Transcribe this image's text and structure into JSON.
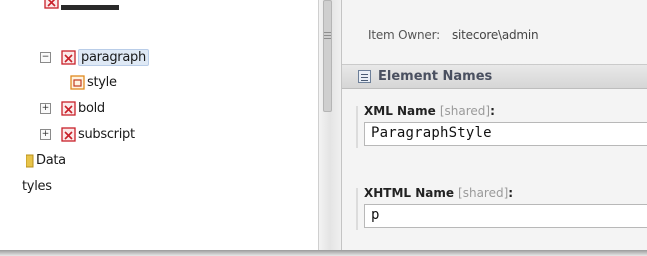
{
  "tree": {
    "items": [
      {
        "label": "",
        "icon": "rendering-icon",
        "expander": "",
        "cut": true
      },
      {
        "label": "paragraph",
        "icon": "rendering-icon",
        "expander": "−",
        "selected": true
      },
      {
        "label": "style",
        "icon": "template-icon",
        "expander": ""
      },
      {
        "label": "bold",
        "icon": "rendering-icon",
        "expander": "+"
      },
      {
        "label": "subscript",
        "icon": "rendering-icon",
        "expander": "+"
      },
      {
        "label": "Data",
        "icon": "folder-icon",
        "expander": ""
      },
      {
        "label": "tyles",
        "icon": "",
        "expander": ""
      }
    ]
  },
  "content": {
    "owner_label": "Item Owner:",
    "owner_value": "sitecore\\admin",
    "section": {
      "title": "Element Names",
      "icon": "section-icon"
    },
    "fields": [
      {
        "label": "XML Name",
        "shared": "[shared]",
        "colon": ":",
        "value": "ParagraphStyle"
      },
      {
        "label": "XHTML Name",
        "shared": "[shared]",
        "colon": ":",
        "value": "p"
      }
    ]
  },
  "colors": {
    "rendering_icon_red": "#c8202a",
    "template_icon_orange": "#e08a1e",
    "folder_yellow": "#e8c44a",
    "section_header": "#d6d6d6",
    "panel_bg": "#f4f4f4"
  }
}
